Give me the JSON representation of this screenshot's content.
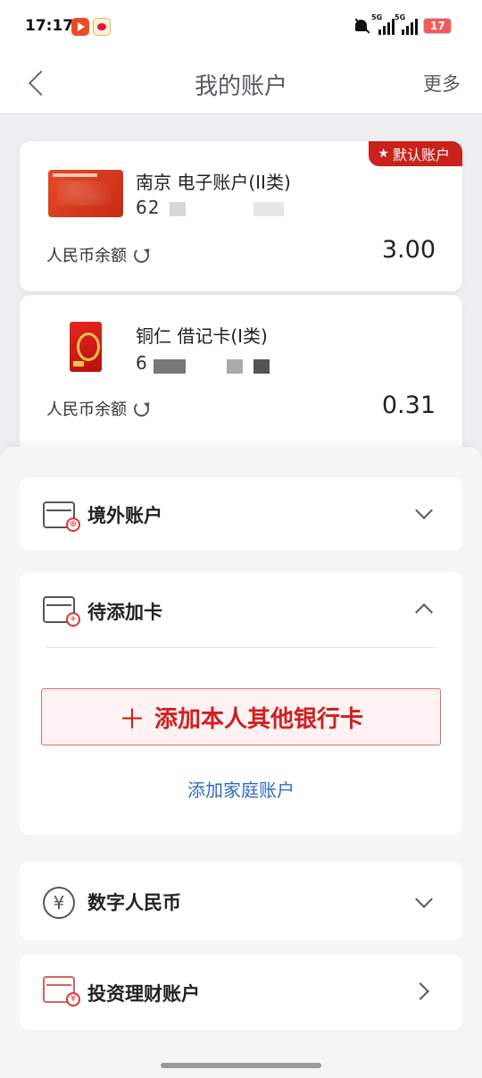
{
  "status_bar": {
    "time": "17:17",
    "signal_label_1": "5G",
    "signal_label_2": "5G",
    "battery": "17"
  },
  "header": {
    "title": "我的账户",
    "more": "更多"
  },
  "cards": [
    {
      "name": "南京 电子账户(II类)",
      "number_visible": "62",
      "badge": "默认账户",
      "balance_label": "人民币余额",
      "balance": "3.00"
    },
    {
      "name": "铜仁 借记卡(I类)",
      "number_visible": "6",
      "balance_label": "人民币余额",
      "balance": "0.31"
    }
  ],
  "sections": {
    "overseas": {
      "label": "境外账户"
    },
    "pending": {
      "label": "待添加卡",
      "add_card_button": "添加本人其他银行卡",
      "family_link": "添加家庭账户"
    },
    "digital_rmb": {
      "label": "数字人民币"
    },
    "investment": {
      "label": "投资理财账户"
    }
  },
  "colors": {
    "brand_red": "#c9221c",
    "link_blue": "#2f6cc2"
  }
}
